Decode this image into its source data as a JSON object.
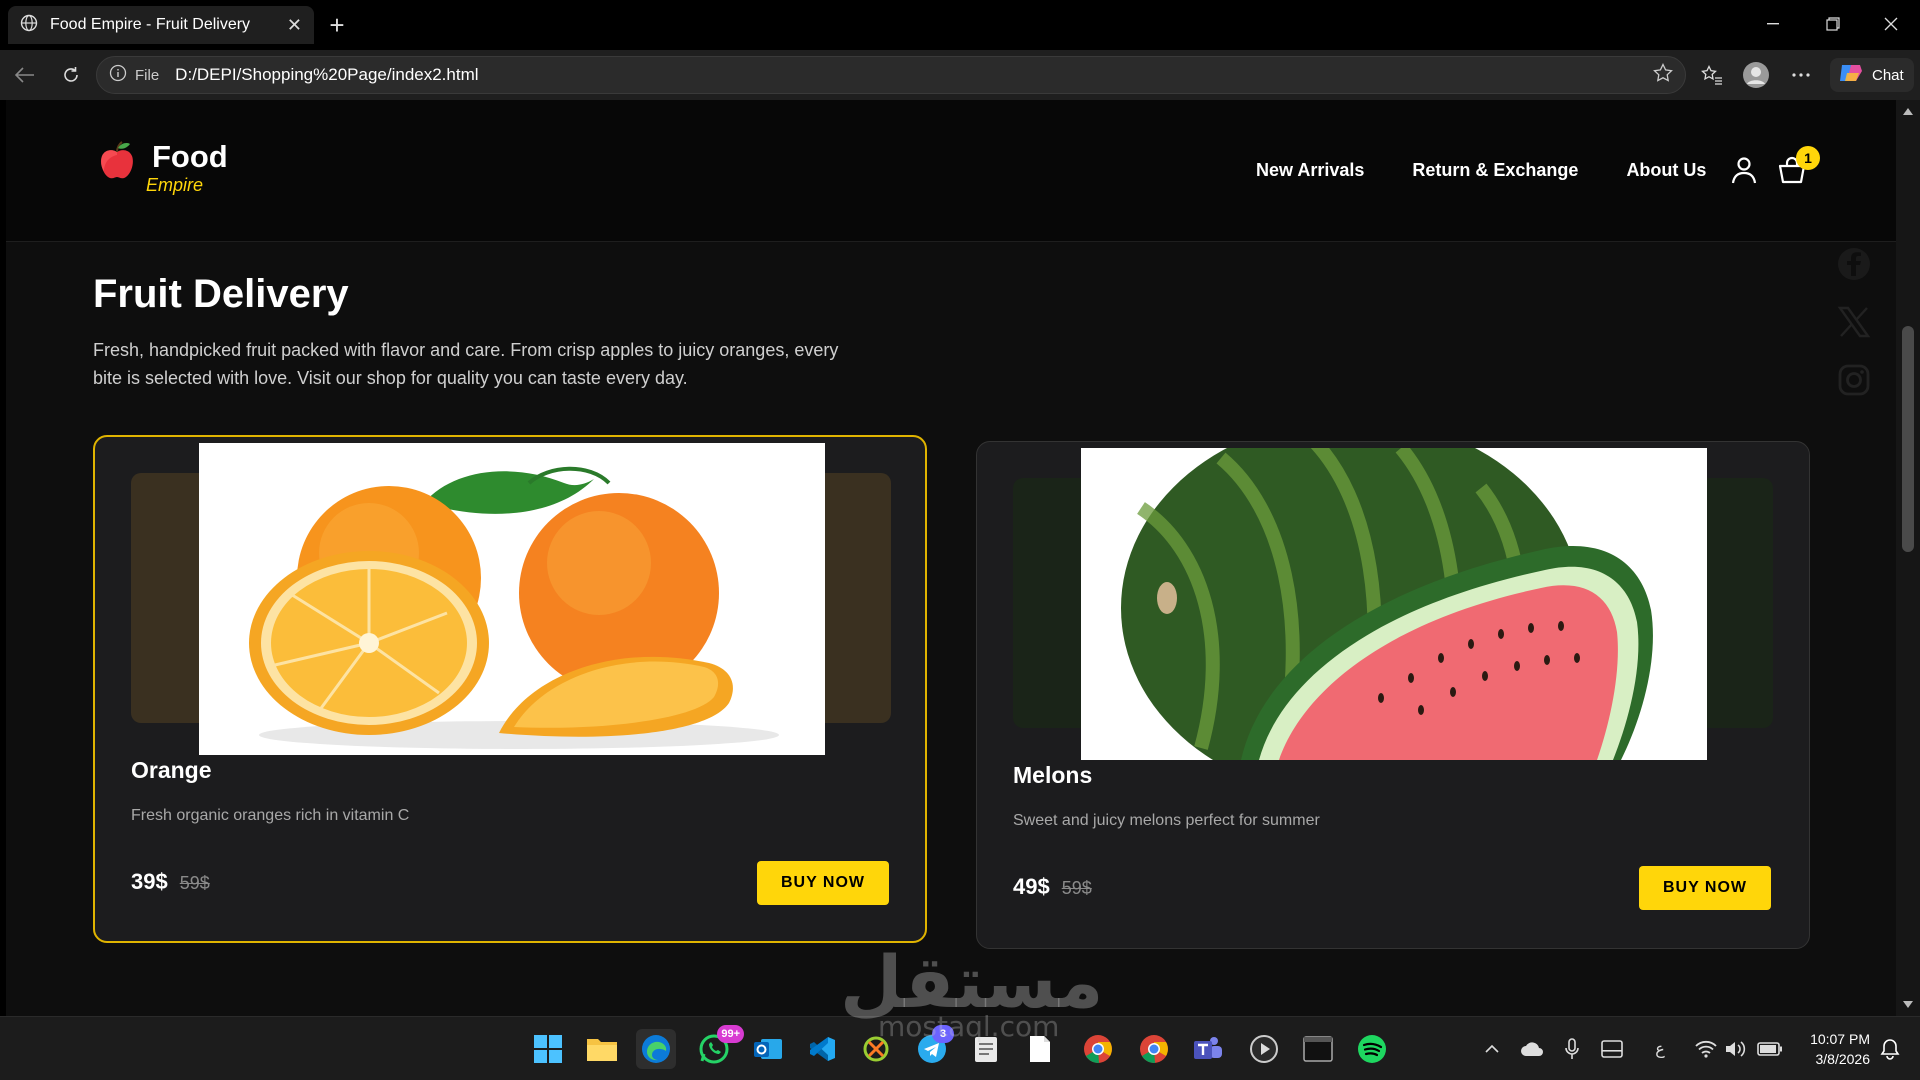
{
  "browser": {
    "tab_title": "Food Empire - Fruit Delivery",
    "address_prefix": "File",
    "url": "D:/DEPI/Shopping%20Page/index2.html",
    "chat_label": "Chat"
  },
  "site": {
    "brand_main": "Food",
    "brand_sub": "Empire",
    "nav": [
      "New Arrivals",
      "Return & Exchange",
      "About Us"
    ],
    "cart_count": "1",
    "accent_color": "#ffd60a"
  },
  "hero": {
    "title": "Fruit Delivery",
    "description": "Fresh, handpicked fruit packed with flavor and care. From crisp apples to juicy oranges, every bite is selected with love. Visit our shop for quality you can taste every day."
  },
  "products": [
    {
      "name": "Orange",
      "description": "Fresh organic oranges rich in vitamin C",
      "price": "39$",
      "old_price": "59$",
      "button": "BUY NOW"
    },
    {
      "name": "Melons",
      "description": "Sweet and juicy melons perfect for summer",
      "price": "49$",
      "old_price": "59$",
      "button": "BUY NOW"
    }
  ],
  "social": [
    "facebook-icon",
    "x-icon",
    "instagram-icon"
  ],
  "watermark": {
    "main": "مستقل",
    "sub": "mostaql.com"
  },
  "taskbar": {
    "whatsapp_badge": "99+",
    "telegram_badge": "3",
    "time": "10:07 PM",
    "date": "3/8/2026",
    "lang": "ع"
  }
}
